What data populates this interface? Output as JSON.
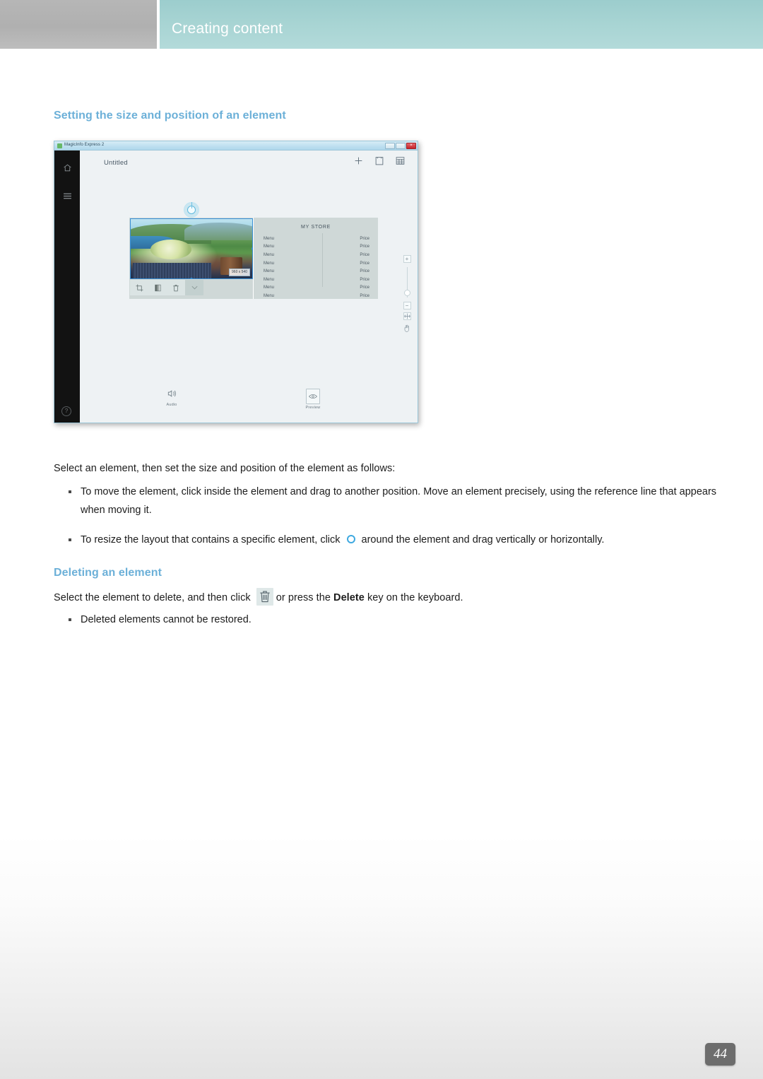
{
  "header": {
    "title": "Creating content",
    "teal_color": "#a9d5d4",
    "grey_color": "#b4b4b4"
  },
  "sections": {
    "size_position": {
      "heading": "Setting the size and position of an element",
      "intro": "Select an element, then set the size and position of the element as follows:",
      "bullets": [
        {
          "text_before": "To move the element, click inside the element and drag to another position. Move an element precisely, using the reference line that appears when moving it.",
          "icon": "",
          "text_after": ""
        },
        {
          "text_before": "To resize the layout that contains a specific element, click",
          "icon": "resize-circle-icon",
          "text_after": "around the element and drag vertically or horizontally."
        }
      ]
    },
    "deleting": {
      "heading": "Deleting an element",
      "sentence_before": "Select the element to delete, and then click",
      "inline_icon": "trash-icon",
      "sentence_middle": "or press the",
      "bold_word": "Delete",
      "sentence_after": "key on the keyboard.",
      "bullets": [
        "Deleted elements cannot be restored."
      ]
    }
  },
  "figure": {
    "window": {
      "title": "MagicInfo Express 2",
      "buttons": [
        "minimize",
        "maximize",
        "close"
      ],
      "close_glyph": "×"
    },
    "rail": {
      "home_icon": "home-icon",
      "menu_icon": "hamburger-menu-icon",
      "help_icon": "help-icon",
      "help_glyph": "?"
    },
    "topbar": {
      "doc_title": "Untitled",
      "actions": [
        "add-icon",
        "page-icon",
        "table-icon"
      ]
    },
    "element": {
      "dimension_label": "960 x 540",
      "selection_color": "#3a8fd4",
      "toolbar": [
        "crop-icon",
        "fill-icon",
        "trash-icon",
        "chevron-down-icon"
      ]
    },
    "store_panel": {
      "title": "MY STORE",
      "rows": [
        {
          "name": "Menu",
          "price": "Price"
        },
        {
          "name": "Menu",
          "price": "Price"
        },
        {
          "name": "Menu",
          "price": "Price"
        },
        {
          "name": "Menu",
          "price": "Price"
        },
        {
          "name": "Menu",
          "price": "Price"
        },
        {
          "name": "Menu",
          "price": "Price"
        },
        {
          "name": "Menu",
          "price": "Price"
        },
        {
          "name": "Menu",
          "price": "Price"
        }
      ]
    },
    "zoom_controls": {
      "plus": "+",
      "minus": "−",
      "fit_icon": "fit-to-screen-icon",
      "hand_icon": "hand-tool-icon"
    },
    "bottom_actions": [
      {
        "label": "Audio",
        "icon": "speaker-icon"
      },
      {
        "label": "Preview",
        "icon": "preview-eye-icon"
      }
    ]
  },
  "footer": {
    "page_number": "44"
  }
}
